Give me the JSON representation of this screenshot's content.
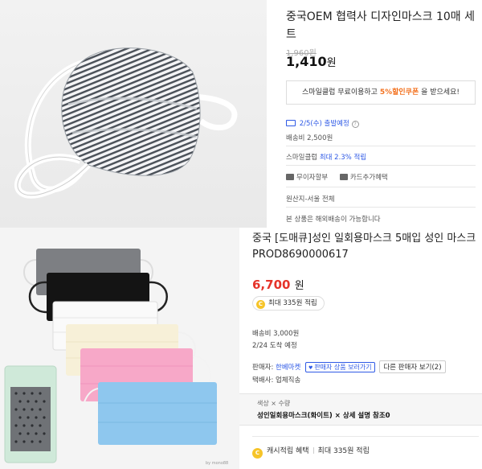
{
  "top_product": {
    "title": "중국OEM 협력사 디자인마스크 10매 세트",
    "old_price": "1,960원",
    "price": "1,410",
    "price_unit": "원",
    "coupon_pre": "스마일클럽 무료이용하고 ",
    "coupon_highlight": "5%할인쿠폰",
    "coupon_post": " 을 받으세요!",
    "ship_date": "2/5(수) 출발예정",
    "ship_info_icon": "info-icon",
    "ship_fee": "배송비 2,500원",
    "smileclub_label": "스마일클럽 ",
    "smileclub_value": "최대 2.3% 적립",
    "benefit_installment": "무이자할부",
    "benefit_card": "카드추가혜택",
    "origin": "원산지-서울 전체",
    "overseas_notice": "본 상품은 해외배송이 가능합니다"
  },
  "bottom_product": {
    "title": "중국 [도매큐]성인 일회용마스크 5매입 성인 마스크 PROD8690000617",
    "price": "6,700",
    "price_unit": "원",
    "points": "최대 335원 적립",
    "ship_fee": "배송비 3,000원",
    "arrival": "2/24 도착 예정",
    "seller_label": "판매자:",
    "seller_name": "한베마켓",
    "seller_products_btn": "판매자 상품 보러가기",
    "other_sellers_btn": "다른 판매자 보기(2)",
    "courier": "택배사: 업체직송",
    "option_header": "색상 × 수량",
    "option_value": "성인일회용마스크(화이트) × 상세 설명 참조0",
    "cash_label": "캐시적립 혜택",
    "cash_value": "최대 335원 적립",
    "image_watermark": "by mono88"
  },
  "colors": {
    "accent_orange": "#f37321",
    "link_blue": "#2f5ae6",
    "price_red": "#e5342a",
    "coin_yellow": "#f6c429"
  }
}
